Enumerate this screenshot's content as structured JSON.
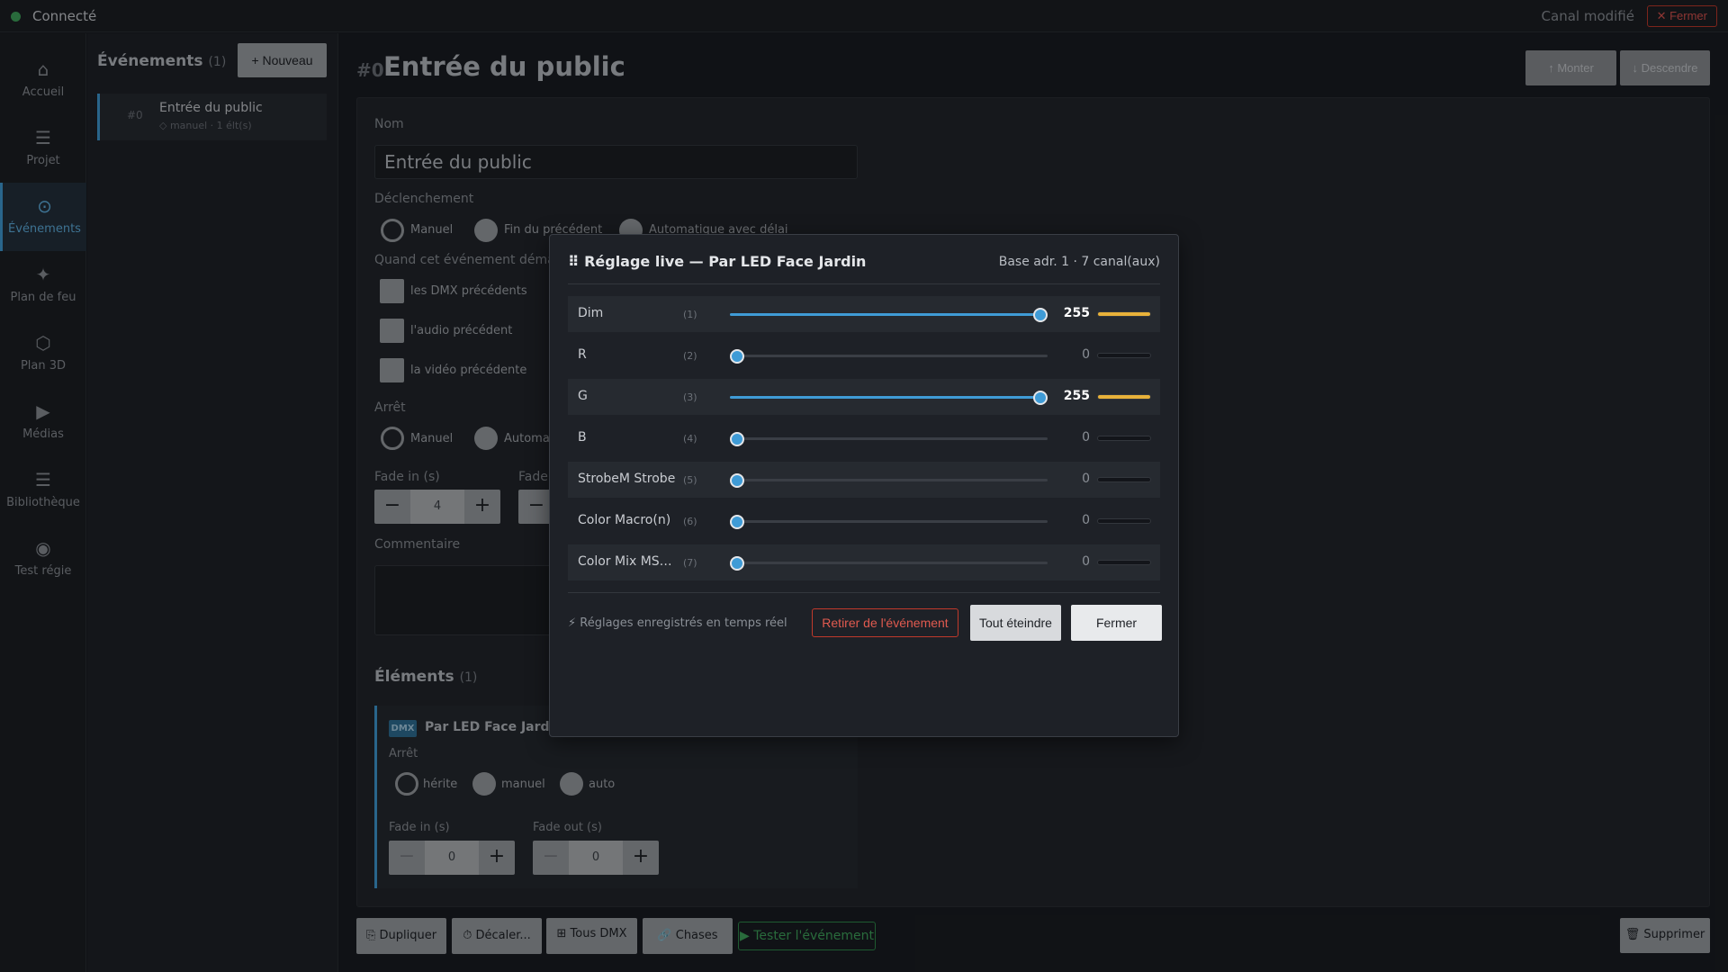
{
  "topbar": {
    "status": "Connecté",
    "status_color": "#3fa55c",
    "modified": "Canal modifié",
    "close_label": "✕ Fermer"
  },
  "sidebar": {
    "items": [
      {
        "icon": "home-icon",
        "glyph": "⌂",
        "label": "Accueil"
      },
      {
        "icon": "menu-icon",
        "glyph": "☰",
        "label": "Projet"
      },
      {
        "icon": "target-icon",
        "glyph": "⊙",
        "label": "Événements"
      },
      {
        "icon": "sparkle-icon",
        "glyph": "✦",
        "label": "Plan de feu"
      },
      {
        "icon": "hexagon-icon",
        "glyph": "⬡",
        "label": "Plan 3D"
      },
      {
        "icon": "play-icon",
        "glyph": "▶",
        "label": "Médias"
      },
      {
        "icon": "list-icon",
        "glyph": "☰",
        "label": "Bibliothèque"
      },
      {
        "icon": "radio-icon",
        "glyph": "◉",
        "label": "Test régie"
      }
    ],
    "active": "Événements"
  },
  "events": {
    "title": "Événements",
    "count": "(1)",
    "new_label": "+ Nouveau",
    "list": [
      {
        "num": "#0",
        "name": "Entrée du public",
        "meta": "◇ manuel · 1 élt(s)"
      }
    ]
  },
  "main": {
    "num": "#0",
    "title": "Entrée du public",
    "up_label": "↑ Monter",
    "down_label": "↓ Descendre",
    "name_label": "Nom",
    "name_value": "Entrée du public",
    "trigger_label": "Déclenchement",
    "trigger_options": [
      "Manuel",
      "Fin du précédent",
      "Automatique avec délai"
    ],
    "trigger_selected": "Manuel",
    "when_label": "Quand cet événement démarr",
    "when_options": [
      "les DMX précédents",
      "l'audio précédent",
      "la vidéo précédente"
    ],
    "stop_label": "Arrêt",
    "stop_options": [
      "Manuel",
      "Automat"
    ],
    "fadein_label": "Fade in (s)",
    "fadein_value": "4",
    "fadeout_label": "Fade",
    "comment_label": "Commentaire",
    "elements_title": "Éléments",
    "elements_count": "(1)",
    "element": {
      "badge": "DMX",
      "name": "Par LED Face Jardin",
      "stop_label": "Arrêt",
      "stop_options": [
        "hérite",
        "manuel",
        "auto"
      ],
      "fadein_label": "Fade in (s)",
      "fadein_value": "0",
      "fadeout_label": "Fade out (s)",
      "fadeout_value": "0"
    }
  },
  "toolbar": {
    "duplicate": "⎘ Dupliquer",
    "shift": "⏱ Décaler...",
    "all_dmx": "⊞ Tous DMX",
    "chases": "🔗 Chases",
    "test": "▶ Tester l'événement",
    "delete": "🗑 Supprimer"
  },
  "modal": {
    "title": "⠿ Réglage live — Par LED Face Jardin",
    "address": "Base adr. 1 · 7 canal(aux)",
    "channels": [
      {
        "name": "Dim",
        "index": "(1)",
        "value": 255
      },
      {
        "name": "R",
        "index": "(2)",
        "value": 0
      },
      {
        "name": "G",
        "index": "(3)",
        "value": 255
      },
      {
        "name": "B",
        "index": "(4)",
        "value": 0
      },
      {
        "name": "StrobeM Strobe",
        "index": "(5)",
        "value": 0
      },
      {
        "name": "Color Macro(n)",
        "index": "(6)",
        "value": 0
      },
      {
        "name": "Color Mix MSp...",
        "index": "(7)",
        "value": 0
      }
    ],
    "max_value": 255,
    "note": "⚡ Réglages enregistrés en temps réel",
    "remove_label": "Retirer de l'événement",
    "all_off_label": "Tout éteindre",
    "close_label": "Fermer",
    "accent": "#3f9bd6",
    "level_color": "#e8b23a"
  }
}
